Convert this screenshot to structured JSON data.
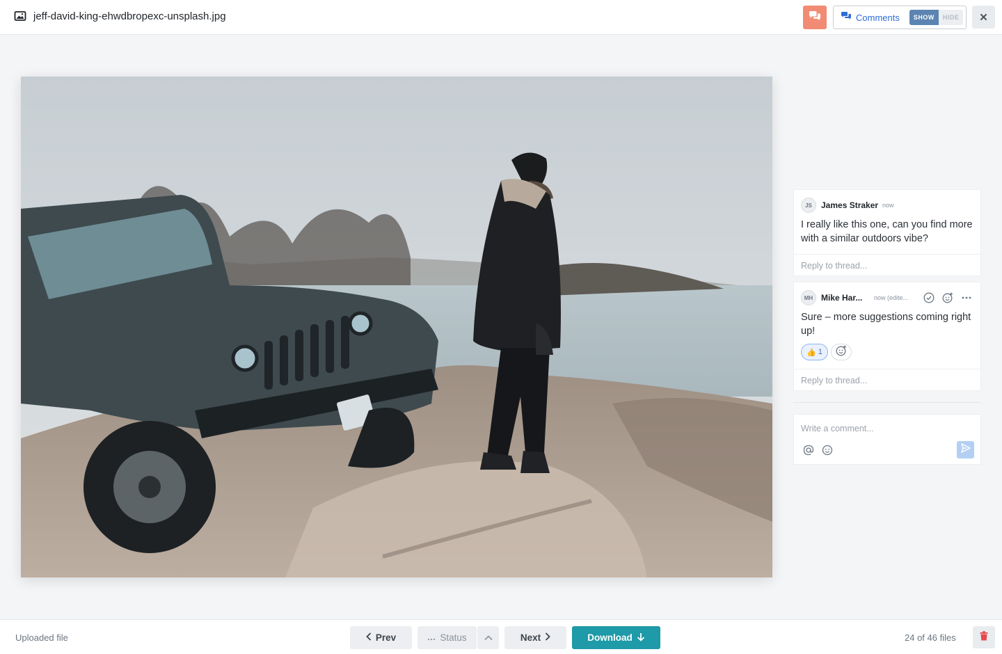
{
  "header": {
    "file_name": "jeff-david-king-ehwdbropexc-unsplash.jpg",
    "comments_label": "Comments",
    "show_label": "SHOW",
    "hide_label": "HIDE",
    "close_glyph": "✕",
    "icons": [
      "image-file-icon",
      "chat-bubbles-icon",
      "comments-icon",
      "close-icon"
    ]
  },
  "comments": {
    "thread1": {
      "initials": "JS",
      "author": "James Straker",
      "time": "now",
      "text": "I really like this one, can you find more with a similar outdoors vibe?",
      "reply_placeholder": "Reply to thread..."
    },
    "thread2": {
      "initials": "MH",
      "author": "Mike Har...",
      "time": "now (edite...",
      "text": "Sure – more suggestions coming right up!",
      "reaction_emoji": "👍",
      "reaction_count": "1",
      "reply_placeholder": "Reply to thread..."
    },
    "composer_placeholder": "Write a comment..."
  },
  "footer": {
    "uploaded_label": "Uploaded file",
    "prev_label": "Prev",
    "status_label": "Status",
    "next_label": "Next",
    "download_label": "Download",
    "counter": "24 of 46 files"
  },
  "colors": {
    "accent_teal": "#1e9aa8",
    "chat_orange": "#f28b74",
    "link_blue": "#2d6cd6",
    "delete_red": "#e5484d"
  }
}
